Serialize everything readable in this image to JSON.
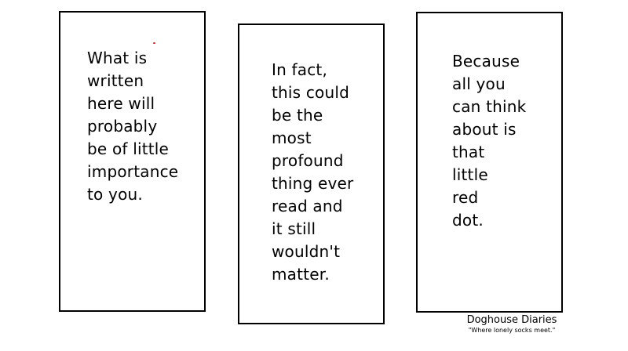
{
  "comic": {
    "panels": [
      {
        "text": "What is\nwritten\nhere will\nprobably\nbe of little\nimportance\nto you."
      },
      {
        "text": "In fact,\nthis could\nbe the\nmost\nprofound\nthing ever\nread and\nit still\nwouldn't\nmatter."
      },
      {
        "text": "Because\nall you\ncan think\nabout is\nthat\nlittle\nred\ndot."
      }
    ],
    "red_dot_color": "#e02020",
    "credit": {
      "title": "Doghouse Diaries",
      "tagline": "\"Where lonely socks meet.\""
    }
  }
}
